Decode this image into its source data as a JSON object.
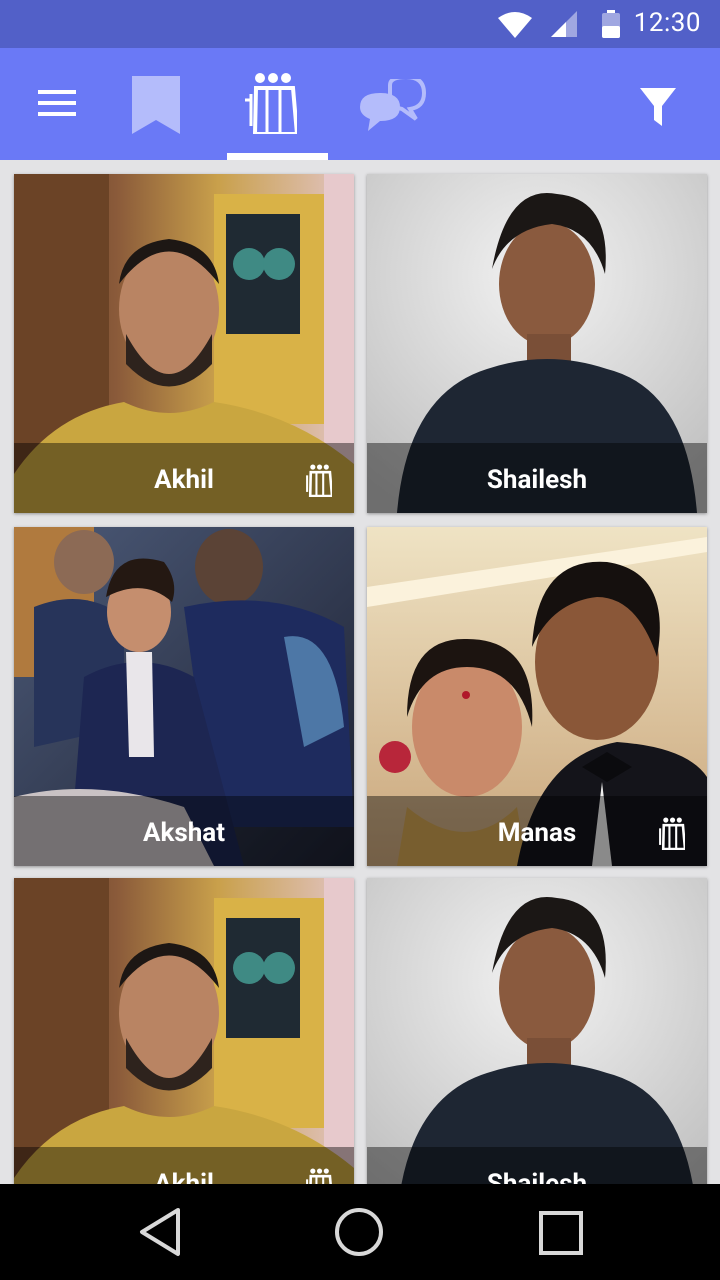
{
  "status_bar": {
    "time": "12:30",
    "icons": [
      "wifi-icon",
      "cell-signal-icon",
      "battery-icon"
    ]
  },
  "app_bar": {
    "menu_icon": "hamburger-menu-icon",
    "tabs": [
      {
        "icon": "bookmark-icon",
        "selected": false
      },
      {
        "icon": "group-icon",
        "selected": true
      },
      {
        "icon": "chat-bubbles-icon",
        "selected": false
      }
    ],
    "filter_icon": "filter-funnel-icon",
    "colors": {
      "status": "#5260c8",
      "toolbar": "#6a79f6",
      "tab_inactive": "#b4bcfb",
      "tab_active": "#ffffff"
    }
  },
  "cards": [
    {
      "name": "Akhil",
      "group": true,
      "photo": "selfie-man-yellow-shirt-owl-poster"
    },
    {
      "name": "Shailesh",
      "group": false,
      "photo": "portrait-man-navy-shirt-white-wall"
    },
    {
      "name": "Akshat",
      "group": false,
      "photo": "man-navy-velvet-blazer-seated"
    },
    {
      "name": "Manas",
      "group": true,
      "photo": "couple-selfie-tuxedo-saree"
    },
    {
      "name": "Akhil",
      "group": true,
      "photo": "selfie-man-yellow-shirt-owl-poster"
    },
    {
      "name": "Shailesh",
      "group": false,
      "photo": "portrait-man-navy-shirt-white-wall"
    }
  ],
  "nav_bar": {
    "buttons": [
      "back-triangle-icon",
      "home-circle-icon",
      "recents-square-icon"
    ]
  }
}
